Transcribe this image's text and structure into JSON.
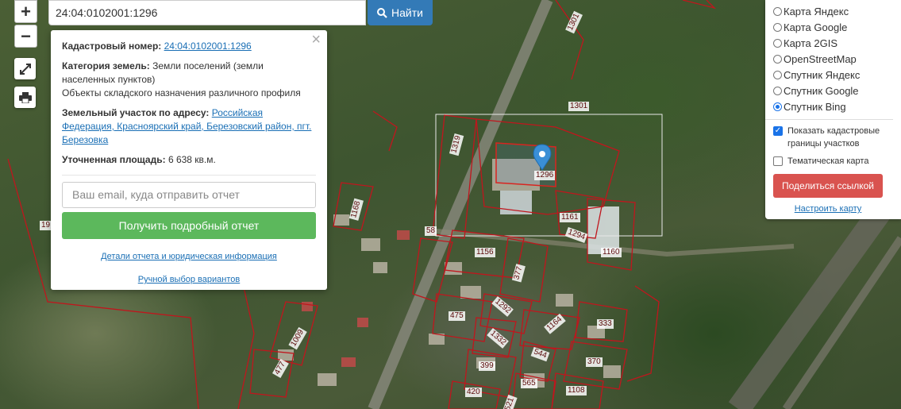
{
  "search": {
    "value": "24:04:0102001:1296",
    "button_label": "Найти",
    "button_icon": "search-icon"
  },
  "controls": {
    "zoom_in": "+",
    "zoom_out": "−",
    "expand_icon": "expand-icon",
    "print_icon": "print-icon"
  },
  "popup": {
    "close": "×",
    "cadastral_label": "Кадастровый номер:",
    "cadastral_value": "24:04:0102001:1296",
    "category_label": "Категория земель:",
    "category_value": "Земли поселений (земли населенных пунктов)",
    "purpose": "Объекты складского назначения различного профиля",
    "address_label": "Земельный участок по адресу:",
    "address_value": "Российская Федерация, Красноярский край, Березовский район, пгт. Березовка",
    "area_label": "Уточненная площадь:",
    "area_value": "6 638 кв.м.",
    "email_placeholder": "Ваш email, куда отправить отчет",
    "report_button": "Получить подробный отчет",
    "details_link": "Детали отчета и юридическая информация",
    "manual_link": "Ручной выбор вариантов"
  },
  "layers": {
    "options": [
      {
        "label": "Карта Яндекс",
        "selected": false
      },
      {
        "label": "Карта Google",
        "selected": false
      },
      {
        "label": "Карта 2GIS",
        "selected": false
      },
      {
        "label": "OpenStreetMap",
        "selected": false
      },
      {
        "label": "Спутник Яндекс",
        "selected": false
      },
      {
        "label": "Спутник Google",
        "selected": false
      },
      {
        "label": "Спутник Bing",
        "selected": true
      }
    ],
    "show_boundaries": "Показать кадастровые границы участков",
    "thematic": "Тематическая карта",
    "share_button": "Поделиться ссылкой",
    "setup_link": "Настроить карту"
  },
  "plots": [
    "1301",
    "1301",
    "1319",
    "1296",
    "1161",
    "1294",
    "1160",
    "1156",
    "377",
    "58",
    "1168",
    "19",
    "1292",
    "1332",
    "475",
    "1164",
    "333",
    "1009",
    "544",
    "399",
    "370",
    "477",
    "565",
    "420",
    "1108",
    "521"
  ],
  "colors": {
    "accent": "#337ab7",
    "report": "#5cb85c",
    "share": "#d9534f",
    "boundary": "#c0161d",
    "marker": "#3a8fd6"
  }
}
